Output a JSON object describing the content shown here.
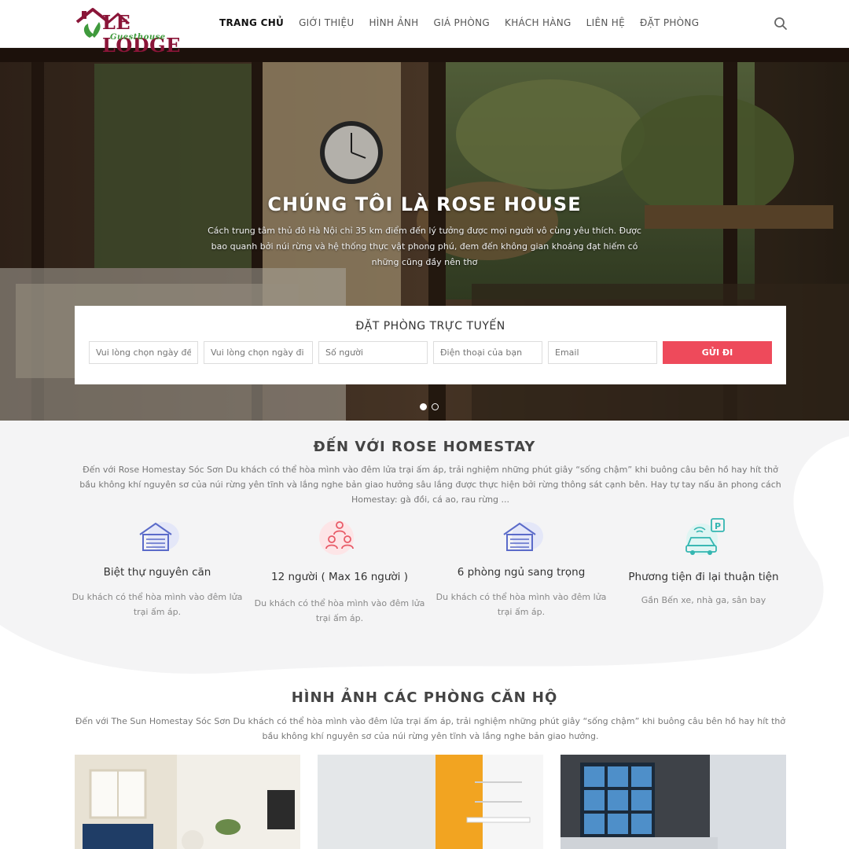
{
  "header": {
    "logo_text": "LE LODGE",
    "logo_sub": "Guesthouse",
    "nav": [
      "TRANG CHỦ",
      "GIỚI THIỆU",
      "HÌNH ẢNH",
      "GIÁ PHÒNG",
      "KHÁCH HÀNG",
      "LIÊN HỆ",
      "ĐẶT PHÒNG"
    ],
    "active_index": 0
  },
  "hero": {
    "title": "CHÚNG TÔI LÀ ROSE HOUSE",
    "desc": "Cách trung tâm thủ đô Hà Nội chỉ 35 km điểm đến lý tưởng được mọi người vô cùng yêu thích. Được bao quanh bởi núi rừng và hệ thống thực vật phong phú, đem đến không gian khoáng đạt hiếm có những cũng đầy nên thơ",
    "slide_count": 2,
    "active_slide": 0
  },
  "booking": {
    "title": "ĐẶT PHÒNG TRỰC TUYẾN",
    "fields": [
      "Vui lòng chọn ngày đến",
      "Vui lòng chọn ngày đi",
      "Số người",
      "Điện thoại của bạn",
      "Email"
    ],
    "submit": "GỬI ĐI"
  },
  "about": {
    "title": "ĐẾN VỚI ROSE HOMESTAY",
    "desc": "Đến với Rose Homestay Sóc Sơn Du khách có thể hòa mình vào đêm lửa trại ấm áp, trải nghiệm những phút giây “sống chậm” khi buông câu bên hồ hay hít thở bầu không khí nguyên sơ của núi rừng yên tĩnh và lắng nghe bản giao hưởng sâu lắng được thực hiện bởi rừng thông sát cạnh bên. Hay tự tay nấu ăn phong cách Homestay: gà đồi, cá ao, rau rừng ...",
    "features": [
      {
        "icon": "garage-house-icon",
        "title": "Biệt thự nguyên căn",
        "desc": "Du khách có thể hòa mình vào đêm lửa trại ấm áp."
      },
      {
        "icon": "people-group-icon",
        "title": "12 người ( Max 16 người )",
        "desc": "Du khách có thể hòa mình vào đêm lửa trại ấm áp."
      },
      {
        "icon": "garage-house-icon",
        "title": "6 phòng ngủ sang trọng",
        "desc": "Du khách có thể hòa mình vào đêm lửa trại ấm áp."
      },
      {
        "icon": "car-parking-icon",
        "title": "Phương tiện đi lại thuận tiện",
        "desc": "Gần Bến xe, nhà ga, sân bay"
      }
    ]
  },
  "gallery": {
    "title": "HÌNH ẢNH CÁC PHÒNG CĂN HỘ",
    "desc": "Đến với The Sun Homestay Sóc Sơn Du khách có thể hòa mình vào đêm lửa trại ấm áp, trải nghiệm những phút giây “sống chậm” khi buông câu bên hồ hay hít thở bầu không khí nguyên sơ của núi rừng yên tĩnh và lắng nghe bản giao hưởng."
  },
  "colors": {
    "accent": "#ee4a5b",
    "brand": "#8a1538",
    "leaf": "#3f9a3c",
    "icon_blue": "#5b6bc9",
    "icon_red": "#e85a67",
    "icon_teal": "#34b6b1"
  }
}
